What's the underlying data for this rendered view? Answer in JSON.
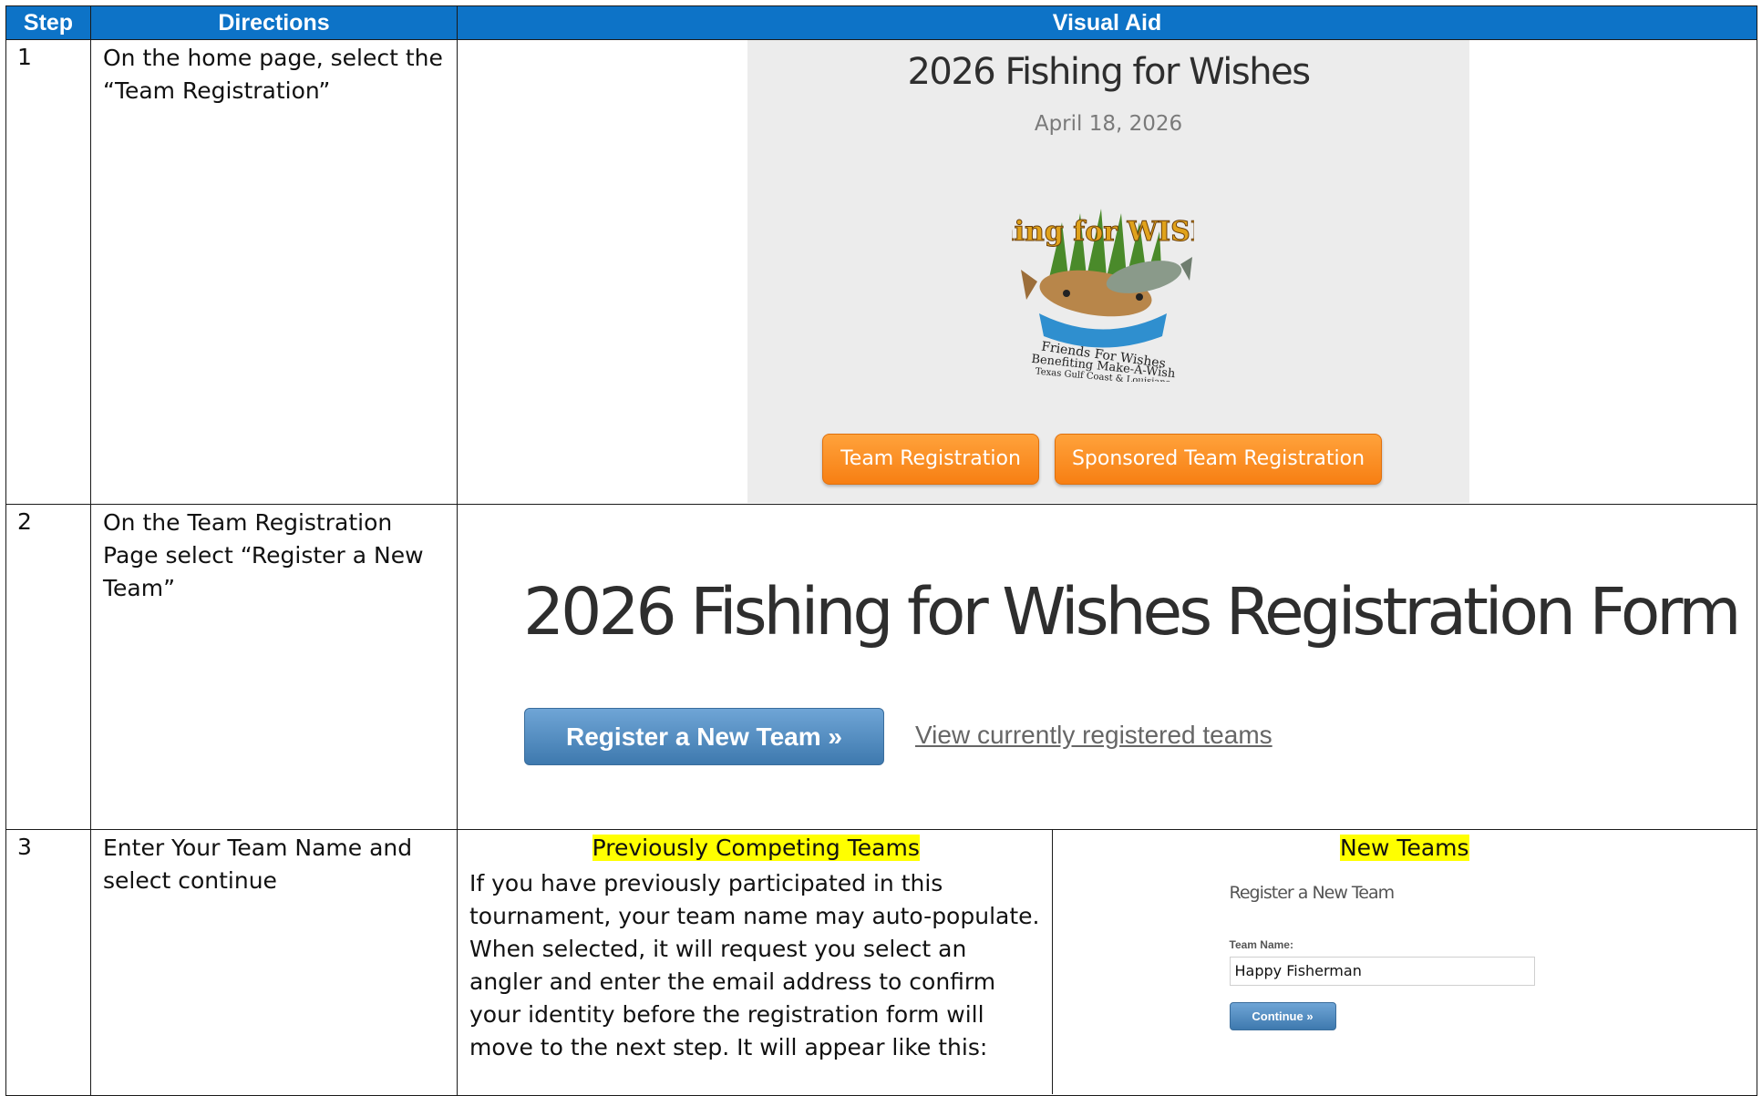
{
  "header": {
    "step": "Step",
    "directions": "Directions",
    "visual_aid": "Visual Aid"
  },
  "rows": [
    {
      "step": "1",
      "directions": "On the home page, select the “Team Registration”",
      "visual": {
        "title": "2026 Fishing for Wishes",
        "date": "April 18, 2026",
        "logo": {
          "title": "Fishing for WISHES",
          "line1": "Friends For Wishes",
          "line2": "Benefiting Make-A-Wish",
          "line3": "Texas Gulf Coast & Louisiana"
        },
        "buttons": {
          "team_registration": "Team Registration",
          "sponsored_team_registration": "Sponsored Team Registration"
        }
      }
    },
    {
      "step": "2",
      "directions": "On the Team Registration Page select “Register a New Team”",
      "visual": {
        "title": "2026 Fishing for Wishes Registration Form",
        "register_button": "Register a New Team »",
        "view_link": "View currently registered teams"
      }
    },
    {
      "step": "3",
      "directions": "Enter Your Team Name and select continue",
      "previous": {
        "heading": "Previously Competing Teams",
        "text": "If you have previously participated in this tournament, your team name may auto-populate. When selected, it will request you select an angler and enter the email address to confirm your identity before the registration form will move to the next step. It will appear like this:"
      },
      "new_teams": {
        "heading": "New Teams",
        "form_heading": "Register a New Team",
        "team_name_label": "Team Name:",
        "team_name_value": "Happy Fisherman",
        "continue_button": "Continue »"
      }
    }
  ],
  "colors": {
    "header_bg": "#0d73c7",
    "orange_button": "#f7891c",
    "blue_button": "#4f86b9",
    "highlight": "#ffff00"
  }
}
